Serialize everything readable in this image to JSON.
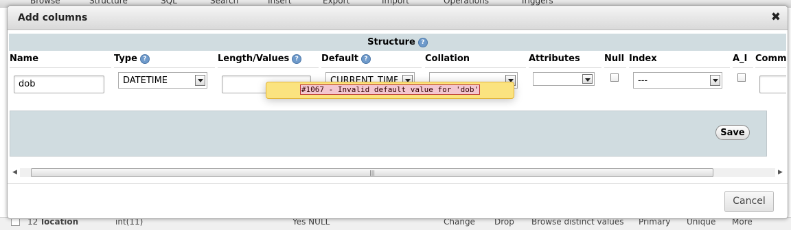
{
  "background": {
    "tabs": [
      "Browse",
      "Structure",
      "SQL",
      "Search",
      "Insert",
      "Export",
      "Import",
      "Operations",
      "Triggers"
    ],
    "bottom_row": {
      "row_number": "12",
      "column_name": "location",
      "type": "int(11)",
      "collation": "Yes  NULL",
      "actions": [
        "Change",
        "Drop",
        "Browse distinct values",
        "Primary",
        "Unique",
        "More"
      ]
    }
  },
  "dialog": {
    "title": "Add columns",
    "close_icon": "close-icon"
  },
  "structure": {
    "label": "Structure",
    "headers": {
      "name": "Name",
      "type": "Type",
      "length": "Length/Values",
      "default": "Default",
      "collation": "Collation",
      "attributes": "Attributes",
      "null": "Null",
      "index": "Index",
      "ai": "A_I",
      "comments": "Comm"
    },
    "row": {
      "name": "dob",
      "type": "DATETIME",
      "length": "",
      "default": "CURRENT_TIME",
      "collation": "",
      "attributes": "",
      "null_checked": false,
      "index": "---",
      "ai_checked": false,
      "comments": ""
    }
  },
  "error": {
    "message": "#1067 - Invalid default value for 'dob'"
  },
  "buttons": {
    "save": "Save",
    "cancel": "Cancel"
  },
  "scrollbar": {
    "left_arrow": "◀",
    "right_arrow": "▶",
    "grip": "|||"
  },
  "colors": {
    "panel": "#d0dce0",
    "error_bg": "#fbe37f",
    "help_icon": "#6e9acb"
  }
}
